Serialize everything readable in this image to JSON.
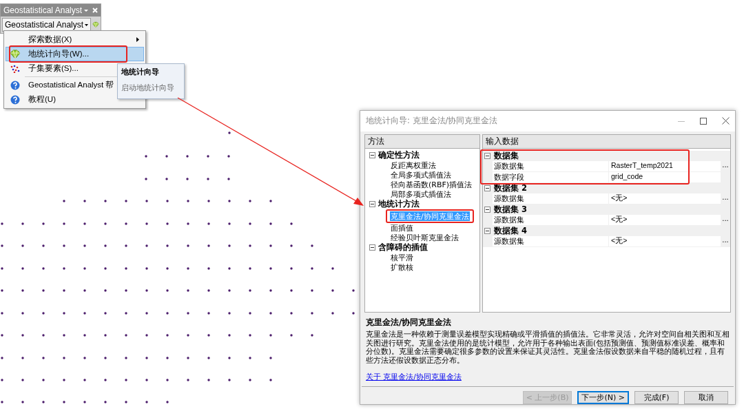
{
  "toolbar": {
    "title": "Geostatistical Analyst",
    "dropdown": "Geostatistical Analyst"
  },
  "menu": [
    {
      "label": "探索数据(X)",
      "kind": "blank",
      "submenu": true,
      "selected": false,
      "separator_before": false,
      "highlighted": false
    },
    {
      "label": "地统计向导(W)...",
      "kind": "wizard",
      "submenu": false,
      "selected": true,
      "separator_before": false,
      "highlighted": true
    },
    {
      "label": "子集要素(S)...",
      "kind": "subset",
      "submenu": false,
      "selected": false,
      "separator_before": false,
      "highlighted": false
    },
    {
      "label": "Geostatistical Analyst 帮",
      "kind": "help",
      "submenu": false,
      "selected": false,
      "separator_before": true,
      "highlighted": false
    },
    {
      "label": "教程(U)",
      "kind": "help",
      "submenu": false,
      "selected": false,
      "separator_before": false,
      "highlighted": false
    }
  ],
  "tooltip": {
    "title": "地统计向导",
    "text": "启动地统计向导"
  },
  "dialog": {
    "title": "地统计向导: 克里金法/协同克里金法",
    "tree_header": "方法",
    "tree": [
      {
        "label": "确定性方法",
        "expanded": true,
        "children": [
          {
            "label": "反距离权重法",
            "selected": false,
            "highlighted": false
          },
          {
            "label": "全局多项式插值法",
            "selected": false,
            "highlighted": false
          },
          {
            "label": "径向基函数(RBF)插值法",
            "selected": false,
            "highlighted": false
          },
          {
            "label": "局部多项式插值法",
            "selected": false,
            "highlighted": false
          }
        ]
      },
      {
        "label": "地统计方法",
        "expanded": true,
        "children": [
          {
            "label": "克里金法/协同克里金法",
            "selected": true,
            "highlighted": true
          },
          {
            "label": "面插值",
            "selected": false,
            "highlighted": false
          },
          {
            "label": "经验贝叶斯克里金法",
            "selected": false,
            "highlighted": false
          }
        ]
      },
      {
        "label": "含障碍的插值",
        "expanded": true,
        "children": [
          {
            "label": "核平滑",
            "selected": false,
            "highlighted": false
          },
          {
            "label": "扩散核",
            "selected": false,
            "highlighted": false
          }
        ]
      }
    ],
    "grid_header": "输入数据",
    "groups": [
      {
        "label": "数据集",
        "expanded": true,
        "highlighted": true,
        "rows": [
          {
            "name": "源数据集",
            "value": "RasterT_temp2021",
            "browse": "..."
          },
          {
            "name": "数据字段",
            "value": "grid_code"
          }
        ]
      },
      {
        "label": "数据集 2",
        "expanded": true,
        "highlighted": false,
        "rows": [
          {
            "name": "源数据集",
            "value": "<无>",
            "browse": "..."
          }
        ]
      },
      {
        "label": "数据集 3",
        "expanded": true,
        "highlighted": false,
        "rows": [
          {
            "name": "源数据集",
            "value": "<无>",
            "browse": "..."
          }
        ]
      },
      {
        "label": "数据集 4",
        "expanded": true,
        "highlighted": false,
        "rows": [
          {
            "name": "源数据集",
            "value": "<无>",
            "browse": "..."
          }
        ]
      }
    ],
    "description": {
      "title": "克里金法/协同克里金法",
      "text": "克里金法是一种依赖于测量误差模型实现精确或平滑插值的插值法。它非常灵活，允许对空间自相关图和互相关图进行研究。克里金法使用的是统计模型，允许用于各种输出表面(包括预测值、预测值标准误差、概率和分位数)。克里金法需要确定很多参数的设置来保证其灵活性。克里金法假设数据来自平稳的随机过程，且有些方法还假设数据正态分布。"
    },
    "link": "关于 克里金法/协同克里金法",
    "buttons": [
      {
        "label": "< 上一步(B)",
        "disabled": true,
        "default": false
      },
      {
        "label": "下一步(N) >",
        "disabled": false,
        "default": true
      },
      {
        "label": "完成(F)",
        "disabled": false,
        "default": false
      },
      {
        "label": "取消",
        "disabled": false,
        "default": false
      }
    ]
  }
}
